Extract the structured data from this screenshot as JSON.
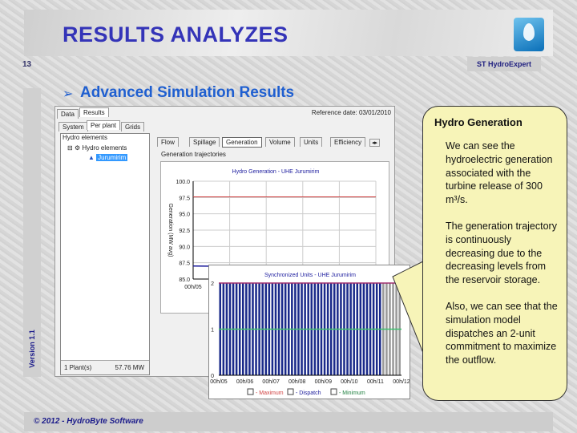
{
  "slide": {
    "title": "RESULTS ANALYZES",
    "page_number": "13",
    "brand": "ST HydroExpert",
    "subtitle": "Advanced Simulation Results",
    "version": "Version 1.1",
    "footer": "© 2012 - HydroByte Software"
  },
  "window": {
    "tabs": [
      "Data",
      "Results"
    ],
    "reference_date": "Reference date: 03/01/2010",
    "subtabs": [
      "System",
      "Per plant",
      "Grids"
    ],
    "tree": {
      "group": "Hydro elements",
      "root": "Hydro elements",
      "plant": "Jurumirim"
    },
    "status": {
      "count": "1 Plant(s)",
      "power": "57.76 MW"
    },
    "chart_tabs": [
      "Flow",
      "Spillage",
      "Generation",
      "Volume",
      "Units",
      "Efficiency"
    ],
    "group_label": "Generation trajectories"
  },
  "callout": {
    "title": "Hydro Generation",
    "paragraphs": [
      "We can see the hydroelectric generation associated with the turbine release of 300 m³/s.",
      "The generation trajectory is continuously decreasing due to the decreasing levels from the reservoir storage.",
      "Also, we can see that the simulation model dispatches an 2-unit commitment to maximize the outflow."
    ]
  },
  "colors": {
    "title": "#3434b8",
    "subtitle": "#1f5fd0",
    "callout": "#f7f4b8",
    "maximum": "#d04040",
    "dispatch": "#1a1a9a",
    "minimum": "#40c070"
  },
  "chart_data": [
    {
      "type": "line",
      "title": "Hydro Generation - UHE Jurumirim",
      "ylabel": "Generation (MW avg)",
      "ylim": [
        85,
        100
      ],
      "yticks": [
        "100.0",
        "97.5",
        "95.0",
        "92.5",
        "90.0",
        "87.5",
        "85.0"
      ],
      "xticks": [
        "00h/05"
      ],
      "grid": true,
      "series": [
        {
          "name": "Maximum",
          "values": [
            97.6,
            97.6
          ]
        },
        {
          "name": "Generation",
          "values": [
            87.0,
            86.8
          ]
        }
      ]
    },
    {
      "type": "bar",
      "title": "Synchronized Units - UHE Jurumirim",
      "ylim": [
        0,
        2
      ],
      "yticks": [
        "2",
        "1",
        "0"
      ],
      "xticks": [
        "00h/05",
        "00h/06",
        "00h/07",
        "00h/08",
        "00h/09",
        "00h/10",
        "00h/11",
        "00h/12"
      ],
      "legend": [
        "Maximum",
        "Dispatch",
        "Minimum"
      ],
      "legend_placement": "bottom",
      "maximum": 2,
      "minimum": 1,
      "dispatch": 2
    }
  ]
}
